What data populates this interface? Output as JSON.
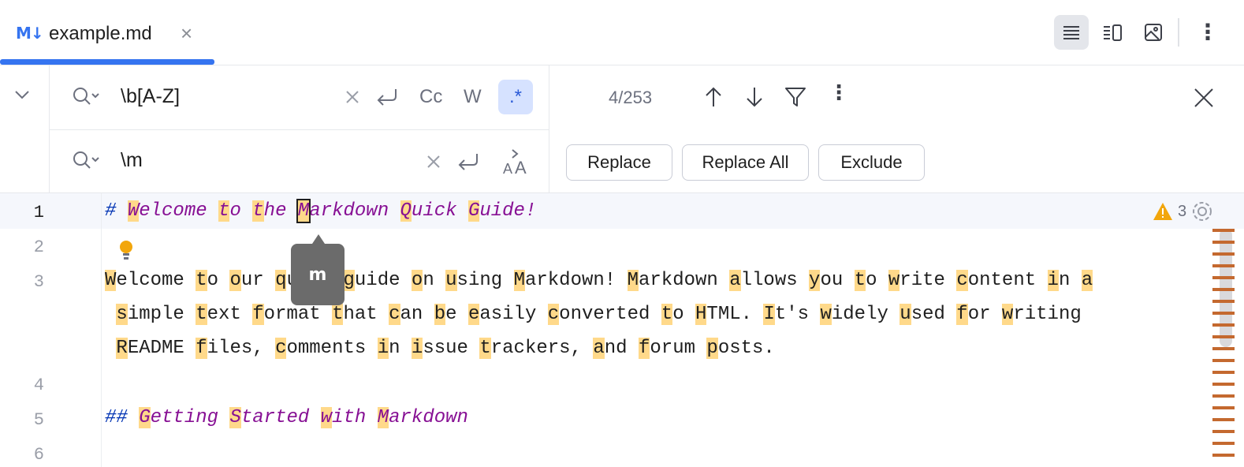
{
  "tab": {
    "icon_text": "M↓",
    "title": "example.md",
    "close_glyph": "×"
  },
  "toolbar": {
    "more_glyph": "⋮"
  },
  "find": {
    "search_value": "\\b[A-Z]",
    "replace_value": "\\m",
    "options": {
      "case": "Cc",
      "words": "W",
      "regex": ".*"
    },
    "match_count": "4/253",
    "more_glyph": "⋮"
  },
  "buttons": {
    "replace": "Replace",
    "replace_all": "Replace All",
    "exclude": "Exclude"
  },
  "editor": {
    "line_numbers": [
      "1",
      "2",
      "3",
      "4",
      "5",
      "6"
    ],
    "lines": [
      [
        "# ",
        "W",
        "elcome ",
        "t",
        "o ",
        "t",
        "he ",
        "M",
        "arkdown ",
        "Q",
        "uick ",
        "G",
        "uide!"
      ],
      [],
      [
        "W",
        "elcome ",
        "t",
        "o ",
        "o",
        "ur ",
        "q",
        "uick ",
        "g",
        "uide ",
        "o",
        "n ",
        "u",
        "sing ",
        "M",
        "arkdown! ",
        "M",
        "arkdown ",
        "a",
        "llows ",
        "y",
        "ou ",
        "t",
        "o ",
        "w",
        "rite ",
        "c",
        "ontent ",
        "i",
        "n ",
        "a"
      ],
      [
        " ",
        "s",
        "imple ",
        "t",
        "ext ",
        "f",
        "ormat ",
        "t",
        "hat ",
        "c",
        "an ",
        "b",
        "e ",
        "e",
        "asily ",
        "c",
        "onverted ",
        "t",
        "o ",
        "H",
        "TML. ",
        "I",
        "t's ",
        "w",
        "idely ",
        "u",
        "sed ",
        "f",
        "or ",
        "w",
        "riting"
      ],
      [
        " ",
        "R",
        "EADME ",
        "f",
        "iles, ",
        "c",
        "omments ",
        "i",
        "n ",
        "i",
        "ssue ",
        "t",
        "rackers, ",
        "a",
        "nd ",
        "f",
        "orum ",
        "p",
        "osts."
      ],
      [],
      [
        "## ",
        "G",
        "etting ",
        "S",
        "tarted ",
        "w",
        "ith ",
        "M",
        "arkdown"
      ]
    ],
    "tooltip": "m",
    "warnings_count": "3"
  },
  "colors": {
    "accent": "#3574f0",
    "match": "#ffd98a",
    "heading": "#871094",
    "marker": "#0033b3",
    "scroll_mark": "#c4692f"
  }
}
